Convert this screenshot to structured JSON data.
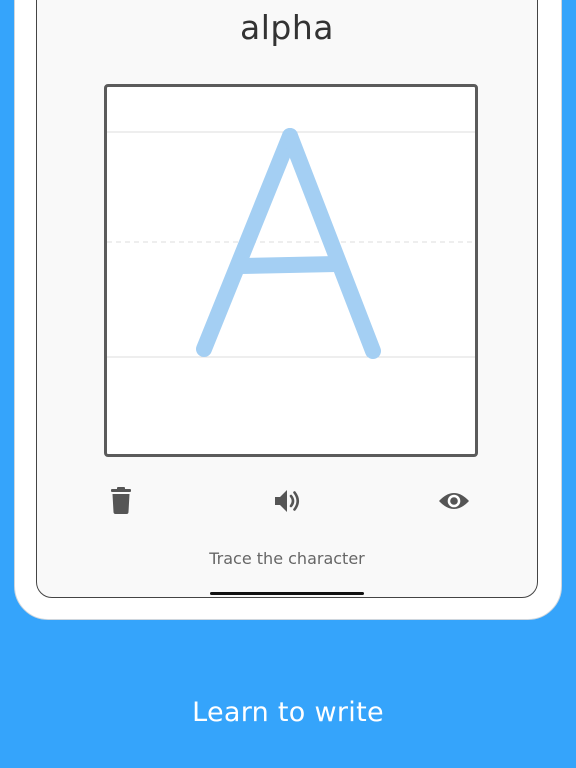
{
  "lesson": {
    "character_name": "alpha",
    "character_glyph": "A",
    "hint": "Trace the character"
  },
  "toolbar": {
    "icons": [
      "trash-icon",
      "speaker-icon",
      "eye-icon"
    ]
  },
  "footer": {
    "tagline": "Learn to write"
  },
  "colors": {
    "background": "#35a4fb",
    "trace_stroke": "#a4cff3",
    "icon": "#555555"
  }
}
